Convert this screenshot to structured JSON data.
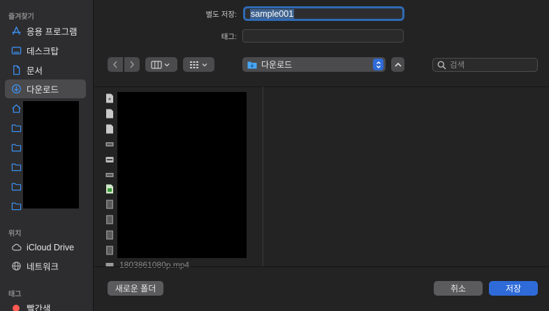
{
  "sidebar": {
    "favorites_header": "즐겨찾기",
    "items": [
      {
        "label": "응용 프로그램",
        "icon": "applications-icon"
      },
      {
        "label": "데스크탑",
        "icon": "desktop-icon"
      },
      {
        "label": "문서",
        "icon": "document-icon"
      },
      {
        "label": "다운로드",
        "icon": "download-icon",
        "active": true
      }
    ],
    "locations_header": "위치",
    "locations": [
      {
        "label": "iCloud Drive",
        "icon": "cloud-icon"
      },
      {
        "label": "네트워크",
        "icon": "network-icon"
      }
    ],
    "tags_header": "태그",
    "tags": [
      {
        "label": "빨간색",
        "color": "#ff5b52"
      }
    ]
  },
  "form": {
    "save_as_label": "별도 저장:",
    "save_as_value": "sample001",
    "tags_label": "태그:",
    "tags_value": ""
  },
  "toolbar": {
    "location": "다운로드",
    "search_placeholder": "검색"
  },
  "files": {
    "partial_name": "1803861080p.mp4"
  },
  "buttons": {
    "new_folder": "새로운 폴더",
    "cancel": "취소",
    "save": "저장"
  },
  "colors": {
    "accent": "#2f6bd8",
    "save_button": "#2f6bd8",
    "sidebar_icon": "#3c8fef"
  }
}
